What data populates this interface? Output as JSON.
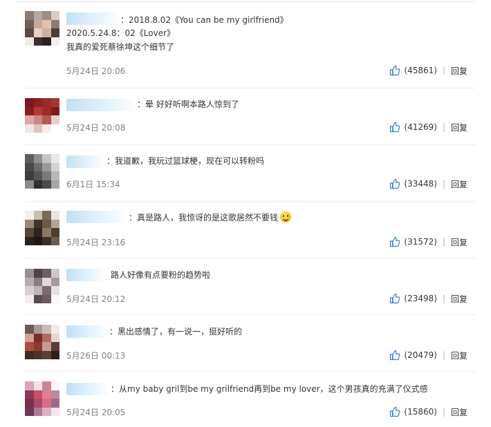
{
  "reply_label": "回复",
  "thumb_icon": "thumbs-up-icon",
  "link_color": "#2b7dd8",
  "comments": [
    {
      "lines": [
        "：2018.8.02《You can be my girlfriend》",
        "2020.5.24.8：02《Lover》",
        "我真的爱死蔡徐坤这个细节了"
      ],
      "time": "5月24日 20:06",
      "likes": "(45861)"
    },
    {
      "lines": [
        "：晕 好好听啊本路人惊到了"
      ],
      "time": "5月24日 20:08",
      "likes": "(41269)"
    },
    {
      "lines": [
        "：我道歉，我玩过篮球梗，现在可以转粉吗"
      ],
      "time": "6月1日 15:34",
      "likes": "(33448)"
    },
    {
      "lines": [
        "：真是路人，我惊讶的是这歌居然不要钱"
      ],
      "emoji": "smiley-emoji",
      "time": "5月24日 23:16",
      "likes": "(31572)"
    },
    {
      "lines": [
        "路人好像有点要粉的趋势啦"
      ],
      "time": "5月24日 20:12",
      "likes": "(23498)"
    },
    {
      "lines": [
        "：黑出感情了，有一说一，挺好听的"
      ],
      "time": "5月26日 00:13",
      "likes": "(20479)"
    },
    {
      "lines": [
        "：从my baby gril到be my grilfriend再到be my lover，这个男孩真的充满了仪式感"
      ],
      "time": "5月24日 20:05",
      "likes": "(15860)"
    }
  ]
}
